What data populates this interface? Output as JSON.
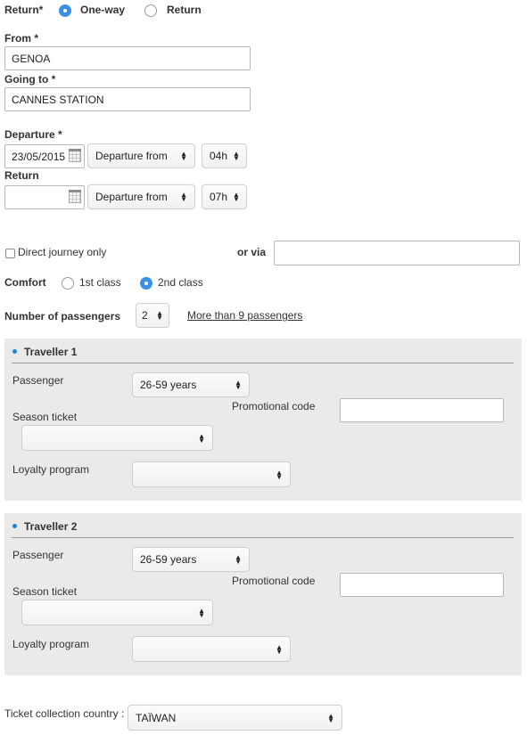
{
  "trip_type": {
    "label": "Return*",
    "options": [
      {
        "label": "One-way",
        "selected": true
      },
      {
        "label": "Return",
        "selected": false
      }
    ]
  },
  "from": {
    "label": "From *",
    "value": "GENOA"
  },
  "going_to": {
    "label": "Going to *",
    "value": "CANNES STATION"
  },
  "departure": {
    "label": "Departure *",
    "date": "23/05/2015",
    "time_mode": "Departure from",
    "hour": "04h"
  },
  "return": {
    "label": "Return",
    "date": "",
    "time_mode": "Departure from",
    "hour": "07h"
  },
  "direct": {
    "label": "Direct journey only",
    "checked": false
  },
  "via": {
    "label": "or via",
    "value": ""
  },
  "comfort": {
    "label": "Comfort",
    "options": [
      {
        "label": "1st class",
        "selected": false
      },
      {
        "label": "2nd class",
        "selected": true
      }
    ]
  },
  "passengers": {
    "label": "Number of passengers",
    "count": "2",
    "more_link": "More than 9 passengers"
  },
  "travellers": [
    {
      "title": "Traveller 1",
      "passenger_label": "Passenger",
      "passenger_value": "26-59 years",
      "promo_label": "Promotional code",
      "promo_value": "",
      "season_label": "Season ticket",
      "season_value": "",
      "loyalty_label": "Loyalty program",
      "loyalty_value": ""
    },
    {
      "title": "Traveller 2",
      "passenger_label": "Passenger",
      "passenger_value": "26-59 years",
      "promo_label": "Promotional code",
      "promo_value": "",
      "season_label": "Season ticket",
      "season_value": "",
      "loyalty_label": "Loyalty program",
      "loyalty_value": ""
    }
  ],
  "collection": {
    "label": "Ticket collection country :",
    "value": "TAÏWAN"
  },
  "colors": {
    "accent": "#3d8fe6",
    "bullet": "#1c86d8",
    "panel": "#ebeae9"
  },
  "icons": {
    "date": "calendar-icon",
    "select": "up-down-caret-icon"
  }
}
